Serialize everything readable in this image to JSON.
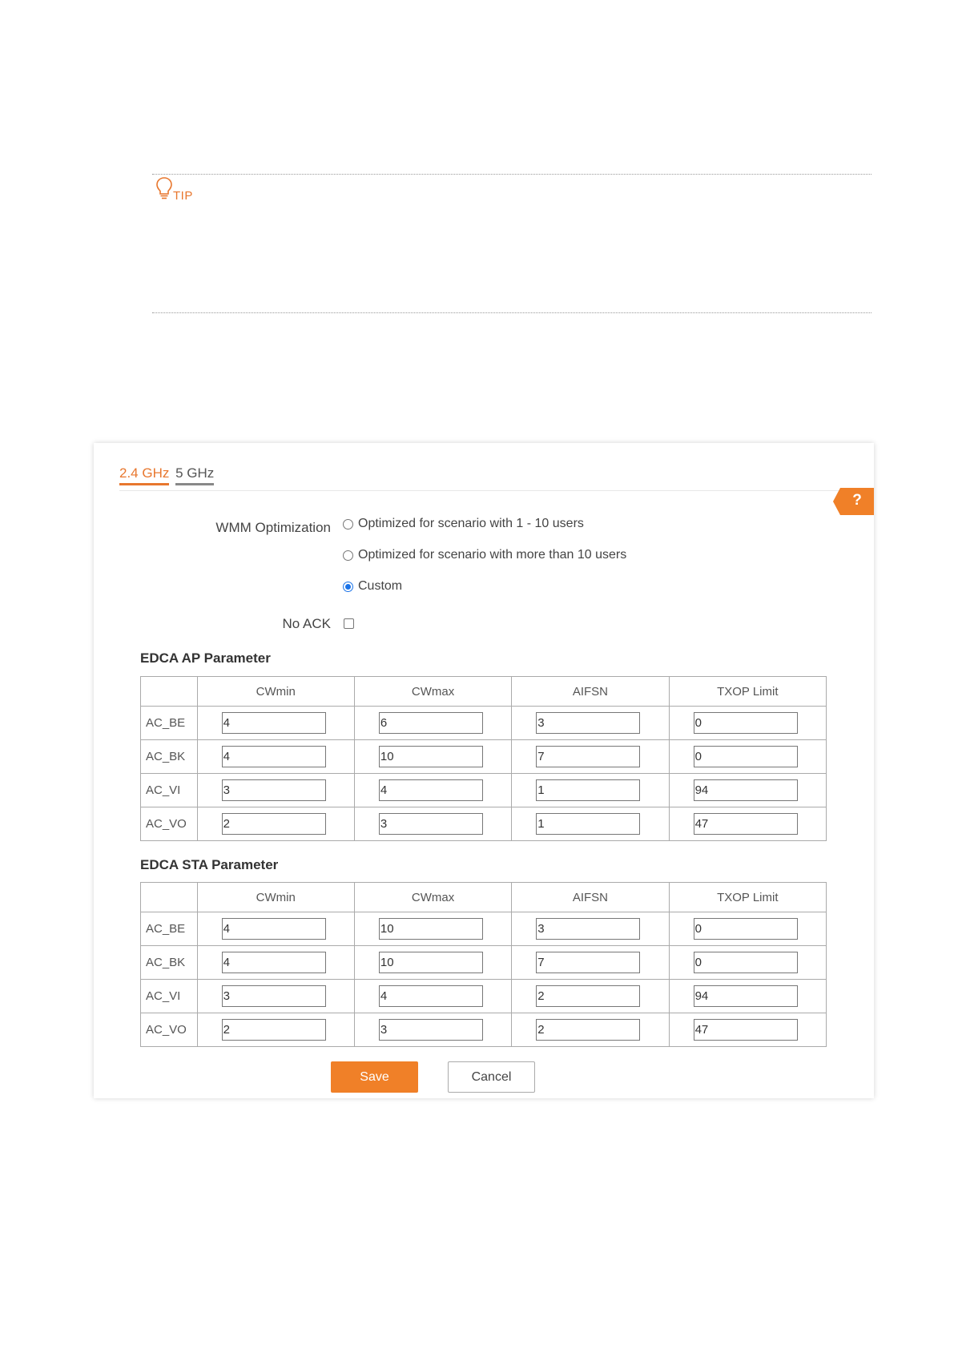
{
  "tip": {
    "label": "TIP"
  },
  "tabs": [
    {
      "label": "2.4 GHz"
    },
    {
      "label": "5 GHz"
    }
  ],
  "help": {
    "label": "?"
  },
  "wmm": {
    "label": "WMM Optimization",
    "options": [
      {
        "label": "Optimized for scenario with 1 - 10 users",
        "checked": false
      },
      {
        "label": "Optimized for scenario with more than 10 users",
        "checked": false
      },
      {
        "label": "Custom",
        "checked": true
      }
    ]
  },
  "no_ack": {
    "label": "No ACK",
    "checked": false
  },
  "columns": [
    "CWmin",
    "CWmax",
    "AIFSN",
    "TXOP Limit"
  ],
  "ap": {
    "title": "EDCA AP Parameter",
    "rows": [
      {
        "label": "AC_BE",
        "values": [
          "4",
          "6",
          "3",
          "0"
        ]
      },
      {
        "label": "AC_BK",
        "values": [
          "4",
          "10",
          "7",
          "0"
        ]
      },
      {
        "label": "AC_VI",
        "values": [
          "3",
          "4",
          "1",
          "94"
        ]
      },
      {
        "label": "AC_VO",
        "values": [
          "2",
          "3",
          "1",
          "47"
        ]
      }
    ]
  },
  "sta": {
    "title": "EDCA STA Parameter",
    "rows": [
      {
        "label": "AC_BE",
        "values": [
          "4",
          "10",
          "3",
          "0"
        ]
      },
      {
        "label": "AC_BK",
        "values": [
          "4",
          "10",
          "7",
          "0"
        ]
      },
      {
        "label": "AC_VI",
        "values": [
          "3",
          "4",
          "2",
          "94"
        ]
      },
      {
        "label": "AC_VO",
        "values": [
          "2",
          "3",
          "2",
          "47"
        ]
      }
    ]
  },
  "buttons": {
    "save": "Save",
    "cancel": "Cancel"
  }
}
